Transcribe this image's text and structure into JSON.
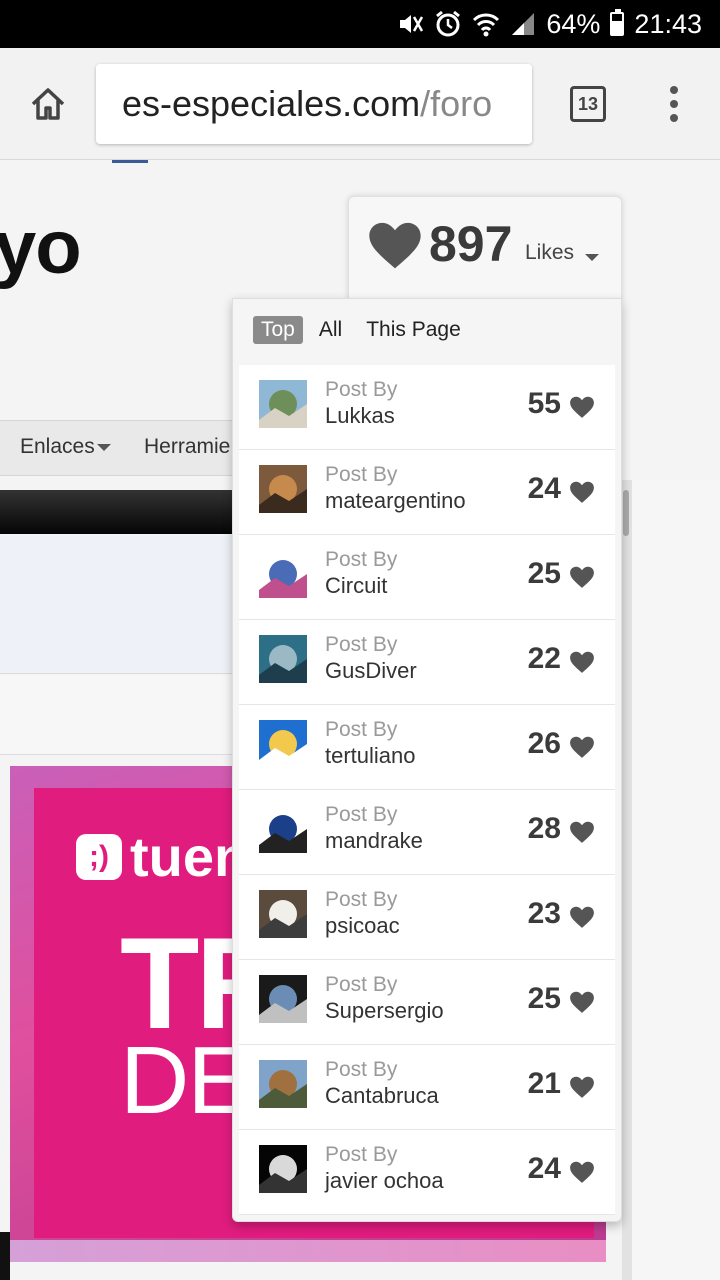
{
  "status_bar": {
    "battery": "64%",
    "battery_level": 0.64,
    "time": "21:43"
  },
  "browser": {
    "url_domain": "es-especiales.com",
    "url_path": "/foro",
    "tab_count": "13"
  },
  "page": {
    "title": "yo",
    "nav_items": [
      "Enlaces",
      "Herramie"
    ]
  },
  "ad": {
    "logo_text": "tuen",
    "headline_1": "TR",
    "headline_2": "DE"
  },
  "likes": {
    "count": "897",
    "label": "Likes",
    "tabs": [
      "Top",
      "All",
      "This Page"
    ],
    "active_tab": "Top",
    "rows": [
      {
        "caption": "Post By",
        "user": "Lukkas",
        "count": "55",
        "colors": [
          "#8fb7d6",
          "#6f8f5a",
          "#d7d2c4"
        ]
      },
      {
        "caption": "Post By",
        "user": "mateargentino",
        "count": "24",
        "colors": [
          "#7d5a3c",
          "#c78a4d",
          "#3b2a1e"
        ]
      },
      {
        "caption": "Post By",
        "user": "Circuit",
        "count": "25",
        "colors": [
          "#ffffff",
          "#4a6bb5",
          "#c04f8e"
        ]
      },
      {
        "caption": "Post By",
        "user": "GusDiver",
        "count": "22",
        "colors": [
          "#2c6f86",
          "#9ab9c4",
          "#1e3e4d"
        ]
      },
      {
        "caption": "Post By",
        "user": "tertuliano",
        "count": "26",
        "colors": [
          "#1f6fd0",
          "#f2c94c",
          "#ffffff"
        ]
      },
      {
        "caption": "Post By",
        "user": "mandrake",
        "count": "28",
        "colors": [
          "#ffffff",
          "#1c3f8a",
          "#222222"
        ]
      },
      {
        "caption": "Post By",
        "user": "psicoac",
        "count": "23",
        "colors": [
          "#5a4b3c",
          "#f0efea",
          "#3d3d3d"
        ]
      },
      {
        "caption": "Post By",
        "user": "Supersergio",
        "count": "25",
        "colors": [
          "#1a1a1a",
          "#6b8db5",
          "#c0c0c0"
        ]
      },
      {
        "caption": "Post By",
        "user": "Cantabruca",
        "count": "21",
        "colors": [
          "#7fa3c9",
          "#a0703f",
          "#4d5b3a"
        ]
      },
      {
        "caption": "Post By",
        "user": "javier ochoa",
        "count": "24",
        "colors": [
          "#050505",
          "#d9d9d9",
          "#333333"
        ]
      }
    ]
  },
  "colors": {
    "heart": "#555555",
    "active_tab": "#8a8a8a",
    "ad_magenta": "#e01c7e"
  }
}
